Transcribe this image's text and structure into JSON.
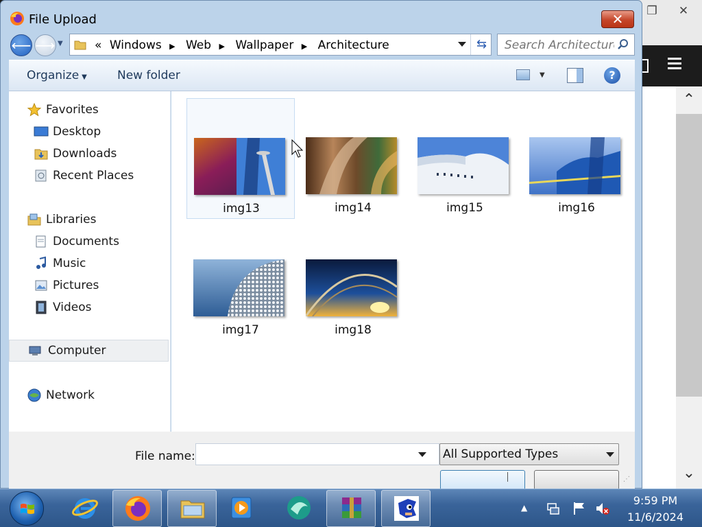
{
  "background_window": {
    "restore_icon": "restore-icon",
    "close_icon": "close-icon",
    "menu_icon": "hamburger-menu-icon",
    "scroll_up_icon": "chevron-up-icon",
    "scroll_down_icon": "chevron-down-icon"
  },
  "dialog": {
    "title": "File Upload",
    "app_icon": "firefox-icon",
    "close_label": "✕",
    "address": {
      "prefix": "«",
      "items": [
        "Windows",
        "Web",
        "Wallpaper",
        "Architecture"
      ]
    },
    "search": {
      "placeholder": "Search Architecture"
    },
    "toolbar": {
      "organize_label": "Organize",
      "new_folder_label": "New folder"
    },
    "nav": {
      "favorites": "Favorites",
      "desktop": "Desktop",
      "downloads": "Downloads",
      "recent_places": "Recent Places",
      "libraries": "Libraries",
      "documents": "Documents",
      "music": "Music",
      "pictures": "Pictures",
      "videos": "Videos",
      "computer": "Computer",
      "network": "Network"
    },
    "files": [
      {
        "name": "img13"
      },
      {
        "name": "img14"
      },
      {
        "name": "img15"
      },
      {
        "name": "img16"
      },
      {
        "name": "img17"
      },
      {
        "name": "img18"
      }
    ],
    "bottom": {
      "file_name_label": "File name:",
      "file_name_value": "",
      "file_type_selected": "All Supported Types"
    }
  },
  "taskbar": {
    "apps": [
      "internet-explorer-icon",
      "firefox-icon",
      "file-explorer-icon",
      "media-player-icon",
      "app-icon",
      "winrar-icon",
      "sonic-game-icon"
    ],
    "clock_time": "9:59 PM",
    "clock_date": "11/6/2024"
  },
  "colors": {
    "dialog_frame": "#bcd3ea",
    "close_button": "#c5462a",
    "taskbar": "#3a649a"
  }
}
